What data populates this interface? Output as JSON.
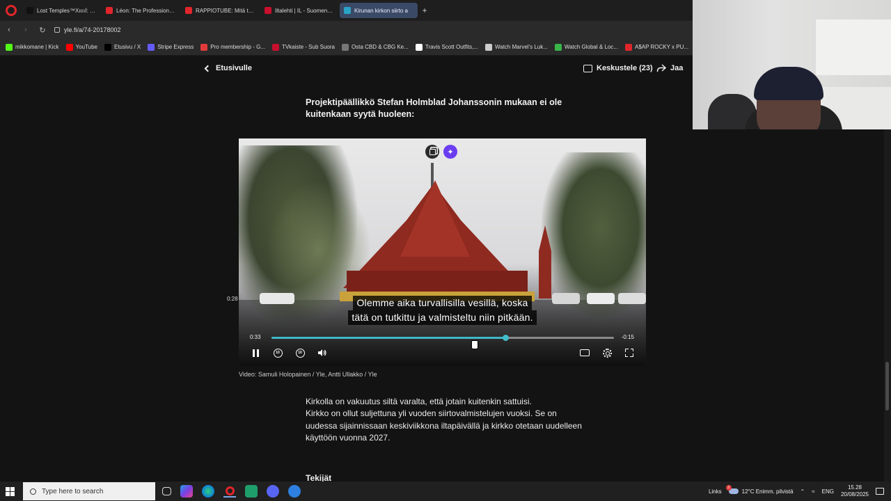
{
  "browser": {
    "tabs": [
      {
        "label": "Lost Temples™Xııııİ: \"Sor",
        "color": "#111111",
        "active": false
      },
      {
        "label": "Léon: The Professional 19",
        "color": "#e0252b",
        "active": false
      },
      {
        "label": "RAPPIOTUBE: Mitä tapaht",
        "color": "#e0252b",
        "active": false
      },
      {
        "label": "Iltalehti | IL - Suomen suu",
        "color": "#c8102e",
        "active": false
      },
      {
        "label": "Kirunan kirkon siirto a",
        "color": "#2aa3c7",
        "active": true
      }
    ],
    "new_tab": "+",
    "url": "yle.fi/a/74-20178002",
    "bookmarks": [
      {
        "label": "mikkomane | Kick",
        "color": "#53fc18"
      },
      {
        "label": "YouTube",
        "color": "#ff0000"
      },
      {
        "label": "Etusivu / X",
        "color": "#000000"
      },
      {
        "label": "Stripe Express",
        "color": "#635bff"
      },
      {
        "label": "Pro membership - G...",
        "color": "#e23b3b"
      },
      {
        "label": "TVkaiste - Sub Suora",
        "color": "#c8102e"
      },
      {
        "label": "Osta CBD & CBG Ke...",
        "color": "#777777"
      },
      {
        "label": "Travis Scott Outfits,...",
        "color": "#ffffff"
      },
      {
        "label": "Watch Marvel's Luk...",
        "color": "#cccccc"
      },
      {
        "label": "Watch Global & Loc...",
        "color": "#3ab54a"
      },
      {
        "label": "A$AP ROCKY x PU...",
        "color": "#e0252b"
      }
    ]
  },
  "nav": {
    "back_label": "Etusivulle",
    "discuss_label": "Keskustele (23)",
    "share_label": "Jaa"
  },
  "article": {
    "lead": "Projektipäällikkö Stefan Holmblad Johanssonin mukaan ei ole kuitenkaan syytä huoleen:",
    "video": {
      "subtitle_line1": "Olemme aika turvallisilla vesillä, koska",
      "subtitle_line2": "tätä on tutkittu ja valmisteltu niin pitkään.",
      "current_time": "0:33",
      "remaining_time": "-0:15",
      "hover_time": "0:28",
      "progress_fraction": 0.683,
      "rewind_label": "10",
      "forward_label": "10",
      "accent_color": "#3fb7c6",
      "ai_button_color": "#6b3df0"
    },
    "caption": "Video: Samuli Holopainen / Yle, Antti Ullakko / Yle",
    "body": [
      "Kirkolla on vakuutus siltä varalta, että jotain kuitenkin sattuisi.",
      "Kirkko on ollut suljettuna yli vuoden siirtovalmistelujen vuoksi. Se on uudessa sijainnissaan keskiviikkona iltapäivällä ja kirkko otetaan uudelleen käyttöön vuonna 2027."
    ],
    "authors_heading": "Tekijät"
  },
  "taskbar": {
    "search_placeholder": "Type here to search",
    "links_label": "Links",
    "weather": "12°C  Enimm. pilvistä",
    "weather_badge": "2",
    "language": "ENG",
    "time": "15.28",
    "date": "20/08/2025"
  }
}
